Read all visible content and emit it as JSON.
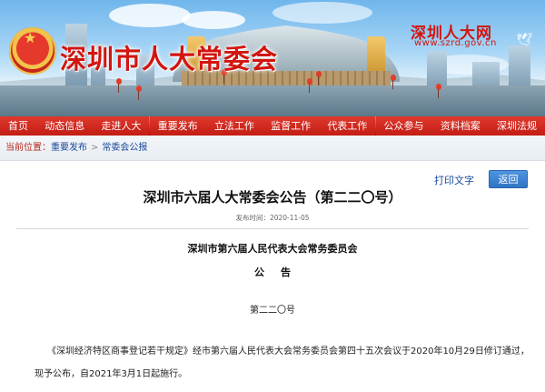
{
  "site": {
    "title": "深圳市人大常委会",
    "brand_cn": "深圳人大网",
    "brand_url": "www.szrd.gov.cn"
  },
  "nav": {
    "items": [
      "首页",
      "动态信息",
      "走进人大",
      "重要发布",
      "立法工作",
      "监督工作",
      "代表工作",
      "公众参与",
      "资料档案",
      "深圳法规"
    ]
  },
  "breadcrumb": {
    "label": "当前位置：",
    "items": [
      "重要发布",
      "常委会公报"
    ],
    "separator": ">"
  },
  "article": {
    "print_label": "打印文字",
    "back_label": "返回",
    "title": "深圳市六届人大常委会公告（第二二〇号）",
    "publish_time": "发布时间：2020-11-05",
    "org": "深圳市第六届人民代表大会常务委员会",
    "notice": "公告",
    "number": "第二二〇号",
    "body": "《深圳经济特区商事登记若干规定》经市第六届人民代表大会常务委员会第四十五次会议于2020年10月29日修订通过，现予公布，自2021年3月1日起施行。"
  },
  "colors": {
    "nav_red": "#c31d14",
    "title_red": "#d2150f",
    "link_blue": "#1a4a9c",
    "button_blue": "#2f73c4"
  }
}
